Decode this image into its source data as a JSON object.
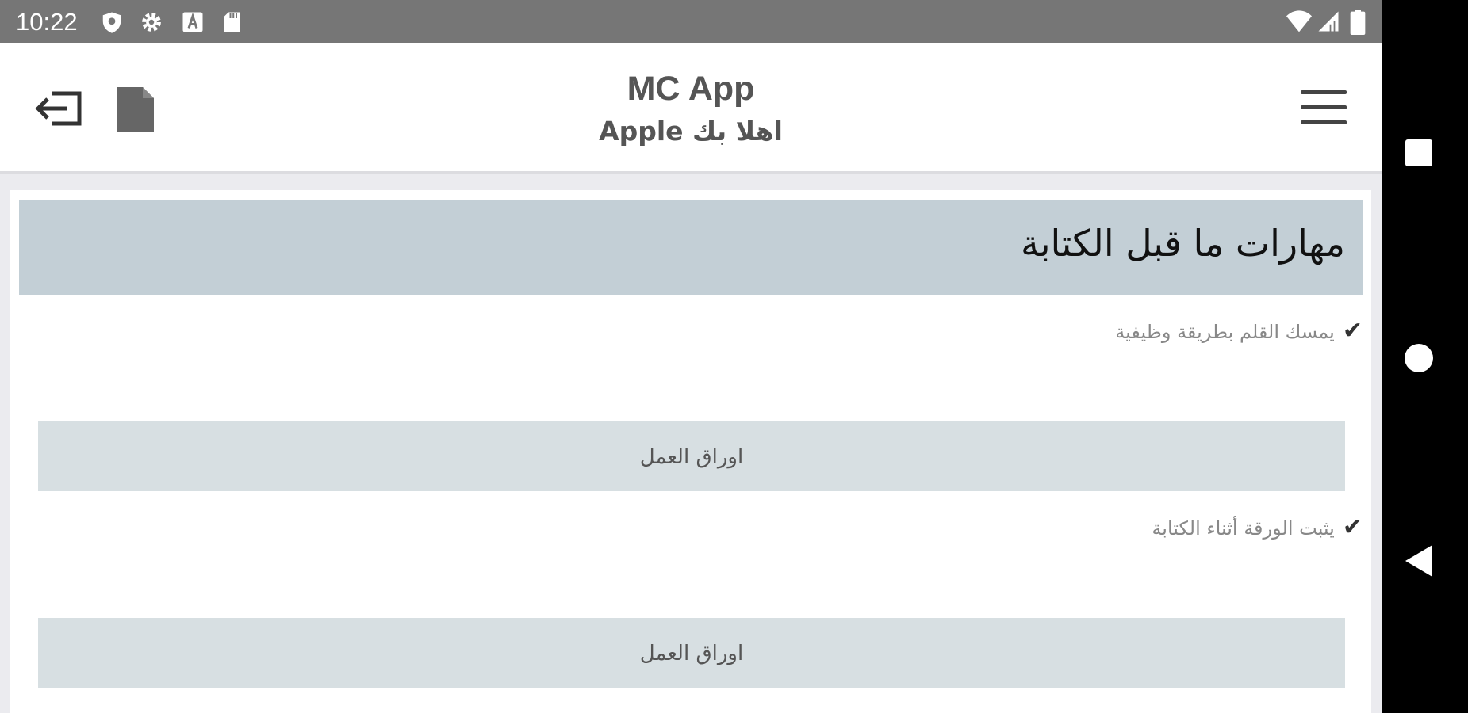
{
  "status_bar": {
    "time": "10:22",
    "icons": [
      "shield-icon",
      "gear-icon",
      "a-box-icon",
      "sd-card-icon",
      "wifi-icon",
      "signal-icon",
      "battery-icon"
    ]
  },
  "app_bar": {
    "title": "MC App",
    "subtitle": "اهلا بك Apple",
    "icons": [
      "logout-icon",
      "document-icon",
      "hamburger-menu-icon"
    ]
  },
  "section": {
    "title": "مهارات ما قبل الكتابة",
    "items": [
      {
        "check": "✔",
        "label": "يمسك  القلم بطريقة وظيفية",
        "button_label": "اوراق العمل"
      },
      {
        "check": "✔",
        "label": "يثبت الورقة أثناء الكتابة",
        "button_label": "اوراق العمل"
      }
    ]
  },
  "nav_bar": {
    "icons": [
      "recents-square-icon",
      "home-circle-icon",
      "back-triangle-icon"
    ]
  },
  "colors": {
    "status_bar": "#767676",
    "section_header": "#c3cfd6",
    "worksheet_button": "#d7dfe2",
    "nav_bar": "#000000"
  }
}
